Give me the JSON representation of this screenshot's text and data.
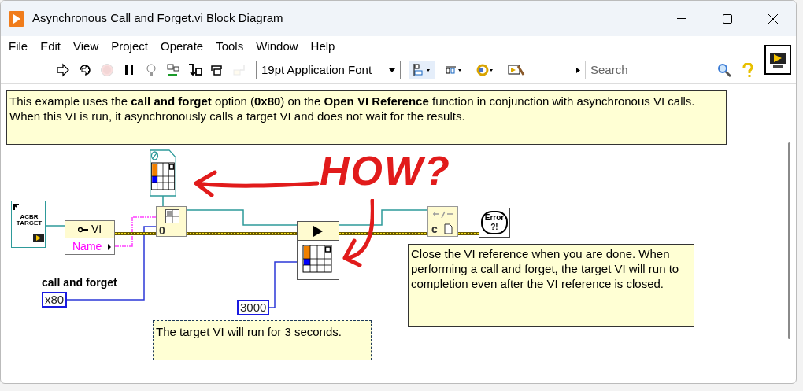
{
  "window": {
    "title": "Asynchronous Call and Forget.vi Block Diagram"
  },
  "menu": [
    {
      "label": "File"
    },
    {
      "label": "Edit"
    },
    {
      "label": "View"
    },
    {
      "label": "Project"
    },
    {
      "label": "Operate"
    },
    {
      "label": "Tools"
    },
    {
      "label": "Window"
    },
    {
      "label": "Help"
    }
  ],
  "toolbar": {
    "buttons": [
      {
        "kind": "run",
        "disabled": false
      },
      {
        "kind": "run-continuous",
        "disabled": false
      },
      {
        "kind": "abort",
        "disabled": true
      },
      {
        "kind": "pause",
        "disabled": false
      },
      {
        "kind": "highlight",
        "disabled": false
      },
      {
        "kind": "retain",
        "disabled": false
      },
      {
        "kind": "step-into",
        "disabled": false
      },
      {
        "kind": "step-over",
        "disabled": false
      },
      {
        "kind": "step-out",
        "disabled": true
      }
    ],
    "font_selector": "19pt Application Font",
    "search": {
      "placeholder": "Search"
    }
  },
  "diagram": {
    "comments": [
      {
        "lines": [
          "This example uses the **call and forget** option (**0x80**) on the **Open VI Reference** function in conjunction with asynchronous VI calls.",
          "When this VI is run, it asynchronously calls a target VI and does not wait for the results."
        ]
      },
      {
        "lines": [
          "Close the VI reference when you are done. When performing a call and forget, the target VI will run to completion even after the VI reference is closed."
        ]
      },
      {
        "lines": [
          "The target VI will run for 3 seconds."
        ]
      }
    ],
    "static_vi_reference": {
      "text": "ACBR TARGET"
    },
    "property_node": {
      "class": "VI",
      "property": "Name"
    },
    "open_vi_reference": {
      "text": "0"
    },
    "close_reference": {
      "text": "c"
    },
    "error_handler": {
      "text": "Error ?!"
    },
    "constants": [
      {
        "label": "call and forget",
        "value": "x80"
      },
      {
        "value": "3000"
      }
    ],
    "annotation": {
      "text": "HOW?"
    }
  }
}
